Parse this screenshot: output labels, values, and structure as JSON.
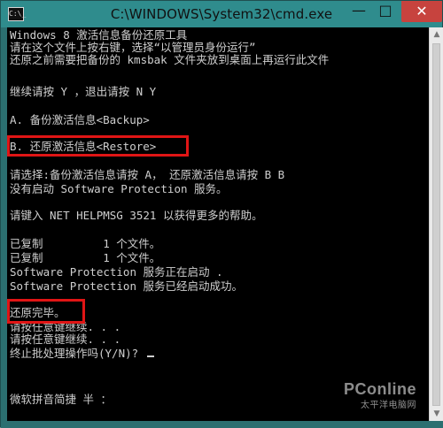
{
  "window": {
    "title": "C:\\WINDOWS\\System32\\cmd.exe",
    "app_icon_text": "C:\\_",
    "buttons": {
      "minimize": "—",
      "maximize": "□",
      "close": "✕"
    }
  },
  "console": {
    "lines": [
      "Windows 8 激活信息备份还原工具",
      "请在这个文件上按右键，选择“以管理员身份运行”",
      "还原之前需要把备份的 kmsbak 文件夹放到桌面上再运行此文件",
      "",
      "继续请按 Y ，退出请按 N Y",
      "",
      "A. 备份激活信息<Backup>",
      "",
      "B. 还原激活信息<Restore>",
      "",
      "请选择:备份激活信息请按 A， 还原激活信息请按 B B",
      "没有启动 Software Protection 服务。",
      "",
      "请键入 NET HELPMSG 3521 以获得更多的帮助。",
      "",
      "已复制         1 个文件。",
      "已复制         1 个文件。",
      "Software Protection 服务正在启动 .",
      "Software Protection 服务已经启动成功。",
      "",
      "还原完毕。",
      "请按任意键继续. . .",
      "请按任意键继续. . .",
      "终止批处理操作吗(Y/N)? ",
      "",
      "",
      "",
      "微软拼音简捷 半 ："
    ]
  },
  "watermark": {
    "brand": "PConline",
    "sub": "太平洋电脑网"
  },
  "colors": {
    "highlight": "#e01515",
    "console_bg": "#000000",
    "console_text": "#cfcfcf"
  }
}
